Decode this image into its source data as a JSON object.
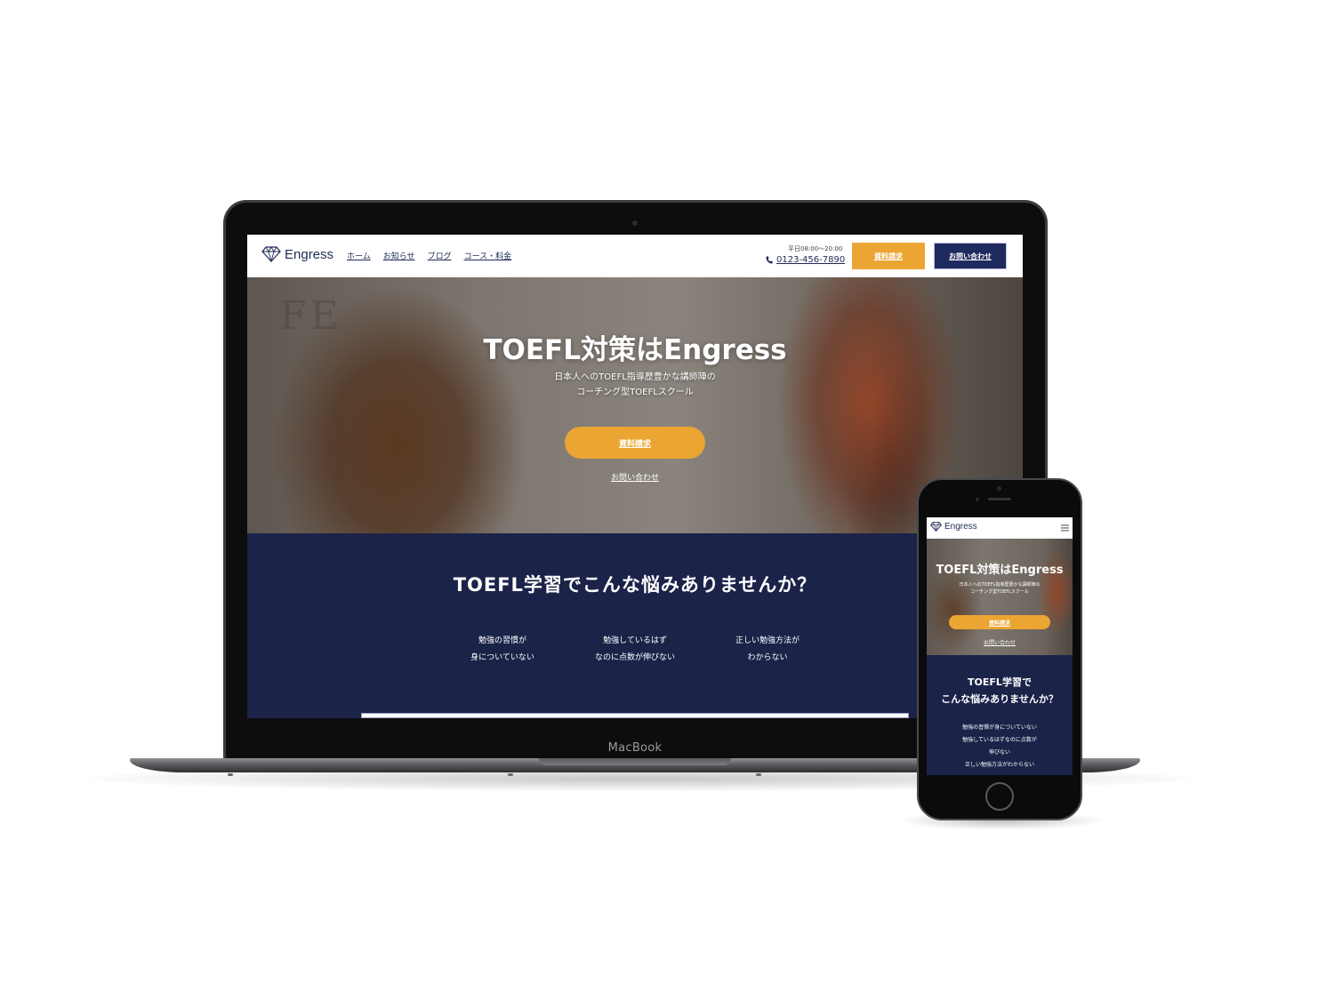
{
  "laptop": {
    "brand": "MacBook",
    "site": {
      "logo_text": "Engress",
      "nav": [
        "ホーム",
        "お知らせ",
        "ブログ",
        "コース・料金"
      ],
      "hours": "平日08:00〜20:00",
      "phone": "0123-456-7890",
      "header_buttons": {
        "document": "資料請求",
        "contact": "お問い合わせ"
      },
      "hero": {
        "board_text": "FE",
        "title": "TOEFL対策はEngress",
        "subtitle_line1": "日本人へのTOEFL指導歴豊かな講師陣の",
        "subtitle_line2": "コーチング型TOEFLスクール",
        "cta": "資料請求",
        "link": "お問い合わせ"
      },
      "problems": {
        "title": "TOEFL学習でこんな悩みありませんか？",
        "items": [
          {
            "line1": "勉強の習慣が",
            "line2": "身についていない"
          },
          {
            "line1": "勉強しているはず",
            "line2": "なのに点数が伸びない"
          },
          {
            "line1": "正しい勉強方法が",
            "line2": "わからない"
          }
        ]
      }
    }
  },
  "phone": {
    "site": {
      "logo_text": "Engress",
      "hero": {
        "title": "TOEFL対策はEngress",
        "subtitle_line1": "日本人へのTOEFL指導歴豊かな講師陣の",
        "subtitle_line2": "コーチング型TOEFLスクール",
        "cta": "資料請求",
        "link": "お問い合わせ"
      },
      "problems": {
        "title_line1": "TOEFL学習で",
        "title_line2": "こんな悩みありませんか？",
        "items": [
          "勉強の習慣が身についていない",
          "勉強しているはずなのに点数が",
          "伸びない",
          "正しい勉強方法がわからない"
        ]
      }
    }
  },
  "colors": {
    "navy": "#1b2349",
    "accent_orange": "#eba532",
    "button_navy": "#1f2a5e"
  },
  "icons": [
    "diamond-logo-icon",
    "phone-icon",
    "hamburger-menu-icon"
  ]
}
